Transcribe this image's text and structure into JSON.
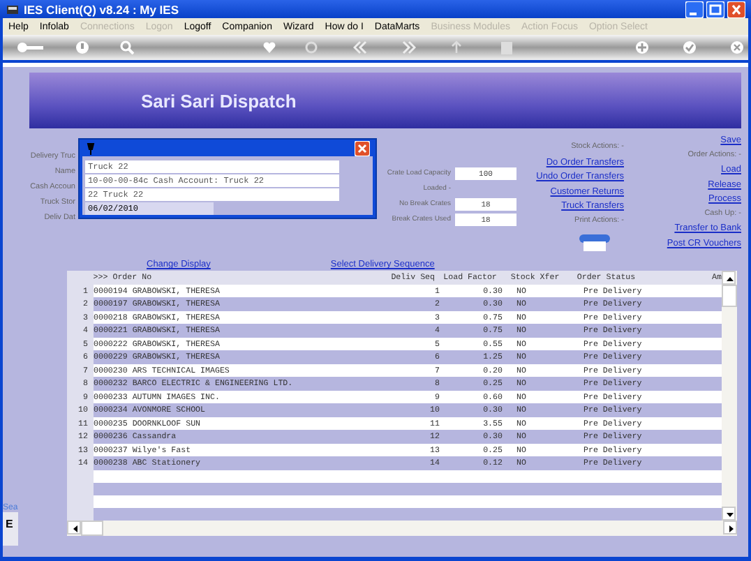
{
  "window": {
    "title": "IES Client(Q) v8.24 : My IES"
  },
  "menu": [
    {
      "label": "Help",
      "disabled": false
    },
    {
      "label": "Infolab",
      "disabled": false
    },
    {
      "label": "Connections",
      "disabled": true
    },
    {
      "label": "Logon",
      "disabled": true
    },
    {
      "label": "Logoff",
      "disabled": false
    },
    {
      "label": "Companion",
      "disabled": false
    },
    {
      "label": "Wizard",
      "disabled": false
    },
    {
      "label": "How do I",
      "disabled": false
    },
    {
      "label": "DataMarts",
      "disabled": false
    },
    {
      "label": "Business Modules",
      "disabled": true
    },
    {
      "label": "Action Focus",
      "disabled": true
    },
    {
      "label": "Option Select",
      "disabled": true
    }
  ],
  "page": {
    "title": "Sari Sari Dispatch"
  },
  "form_labels": [
    "Delivery Truc",
    "Name",
    "Cash Accoun",
    "Truck Stor",
    "Deliv Dat"
  ],
  "popup": {
    "fields": [
      "Truck 22",
      "10-00-00-84c Cash Account: Truck 22",
      "22 Truck 22",
      "06/02/2010"
    ]
  },
  "capacity_fields": [
    {
      "label": "Crate Load Capacity",
      "value": "100"
    },
    {
      "label": "Loaded -"
    },
    {
      "label": "No Break Crates",
      "value": "18"
    },
    {
      "label": "Break Crates Used",
      "value": "18"
    }
  ],
  "stock_actions": [
    {
      "kind": "heading",
      "text": "Stock Actions: -"
    },
    {
      "kind": "link",
      "text": "Do Order Transfers"
    },
    {
      "kind": "link",
      "text": "Undo Order Transfers"
    },
    {
      "kind": "link",
      "text": "Customer Returns"
    },
    {
      "kind": "link",
      "text": "Truck Transfers"
    },
    {
      "kind": "heading",
      "text": "Print Actions: -"
    }
  ],
  "order_actions": [
    {
      "kind": "link",
      "text": "Save"
    },
    {
      "kind": "heading",
      "text": "Order Actions: -"
    },
    {
      "kind": "link",
      "text": "Load"
    },
    {
      "kind": "link",
      "text": "Release"
    },
    {
      "kind": "link",
      "text": "Process"
    },
    {
      "kind": "heading",
      "text": "Cash Up: -"
    },
    {
      "kind": "link",
      "text": "Transfer to Bank"
    },
    {
      "kind": "link",
      "text": "Post CR Vouchers"
    }
  ],
  "links": [
    "Change Display",
    "Select Delivery Sequence"
  ],
  "table": {
    "columns": [
      "",
      ">>> Order No",
      "Deliv Seq",
      "Load Factor",
      "Stock Xfer",
      "Order Status",
      "Am"
    ],
    "rows": [
      [
        "1",
        "0000194 GRABOWSKI, THERESA",
        "1",
        "0.30",
        "NO",
        "Pre Delivery"
      ],
      [
        "2",
        "0000197 GRABOWSKI, THERESA",
        "2",
        "0.30",
        "NO",
        "Pre Delivery"
      ],
      [
        "3",
        "0000218 GRABOWSKI, THERESA",
        "3",
        "0.75",
        "NO",
        "Pre Delivery"
      ],
      [
        "4",
        "0000221 GRABOWSKI, THERESA",
        "4",
        "0.75",
        "NO",
        "Pre Delivery"
      ],
      [
        "5",
        "0000222 GRABOWSKI, THERESA",
        "5",
        "0.55",
        "NO",
        "Pre Delivery"
      ],
      [
        "6",
        "0000229 GRABOWSKI, THERESA",
        "6",
        "1.25",
        "NO",
        "Pre Delivery"
      ],
      [
        "7",
        "0000230 ARS TECHNICAL IMAGES",
        "7",
        "0.20",
        "NO",
        "Pre Delivery"
      ],
      [
        "8",
        "0000232 BARCO ELECTRIC & ENGINEERING LTD.",
        "8",
        "0.25",
        "NO",
        "Pre Delivery"
      ],
      [
        "9",
        "0000233 AUTUMN IMAGES INC.",
        "9",
        "0.60",
        "NO",
        "Pre Delivery"
      ],
      [
        "10",
        "0000234 AVONMORE SCHOOL",
        "10",
        "0.30",
        "NO",
        "Pre Delivery"
      ],
      [
        "11",
        "0000235 DOORNKLOOF SUN",
        "11",
        "3.55",
        "NO",
        "Pre Delivery"
      ],
      [
        "12",
        "0000236 Cassandra",
        "12",
        "0.30",
        "NO",
        "Pre Delivery"
      ],
      [
        "13",
        "0000237 Wilye's Fast",
        "13",
        "0.25",
        "NO",
        "Pre Delivery"
      ],
      [
        "14",
        "0000238 ABC Stationery",
        "14",
        "0.12",
        "NO",
        "Pre Delivery"
      ]
    ]
  },
  "side_tab": {
    "labels": [
      "Sea",
      "E"
    ]
  }
}
